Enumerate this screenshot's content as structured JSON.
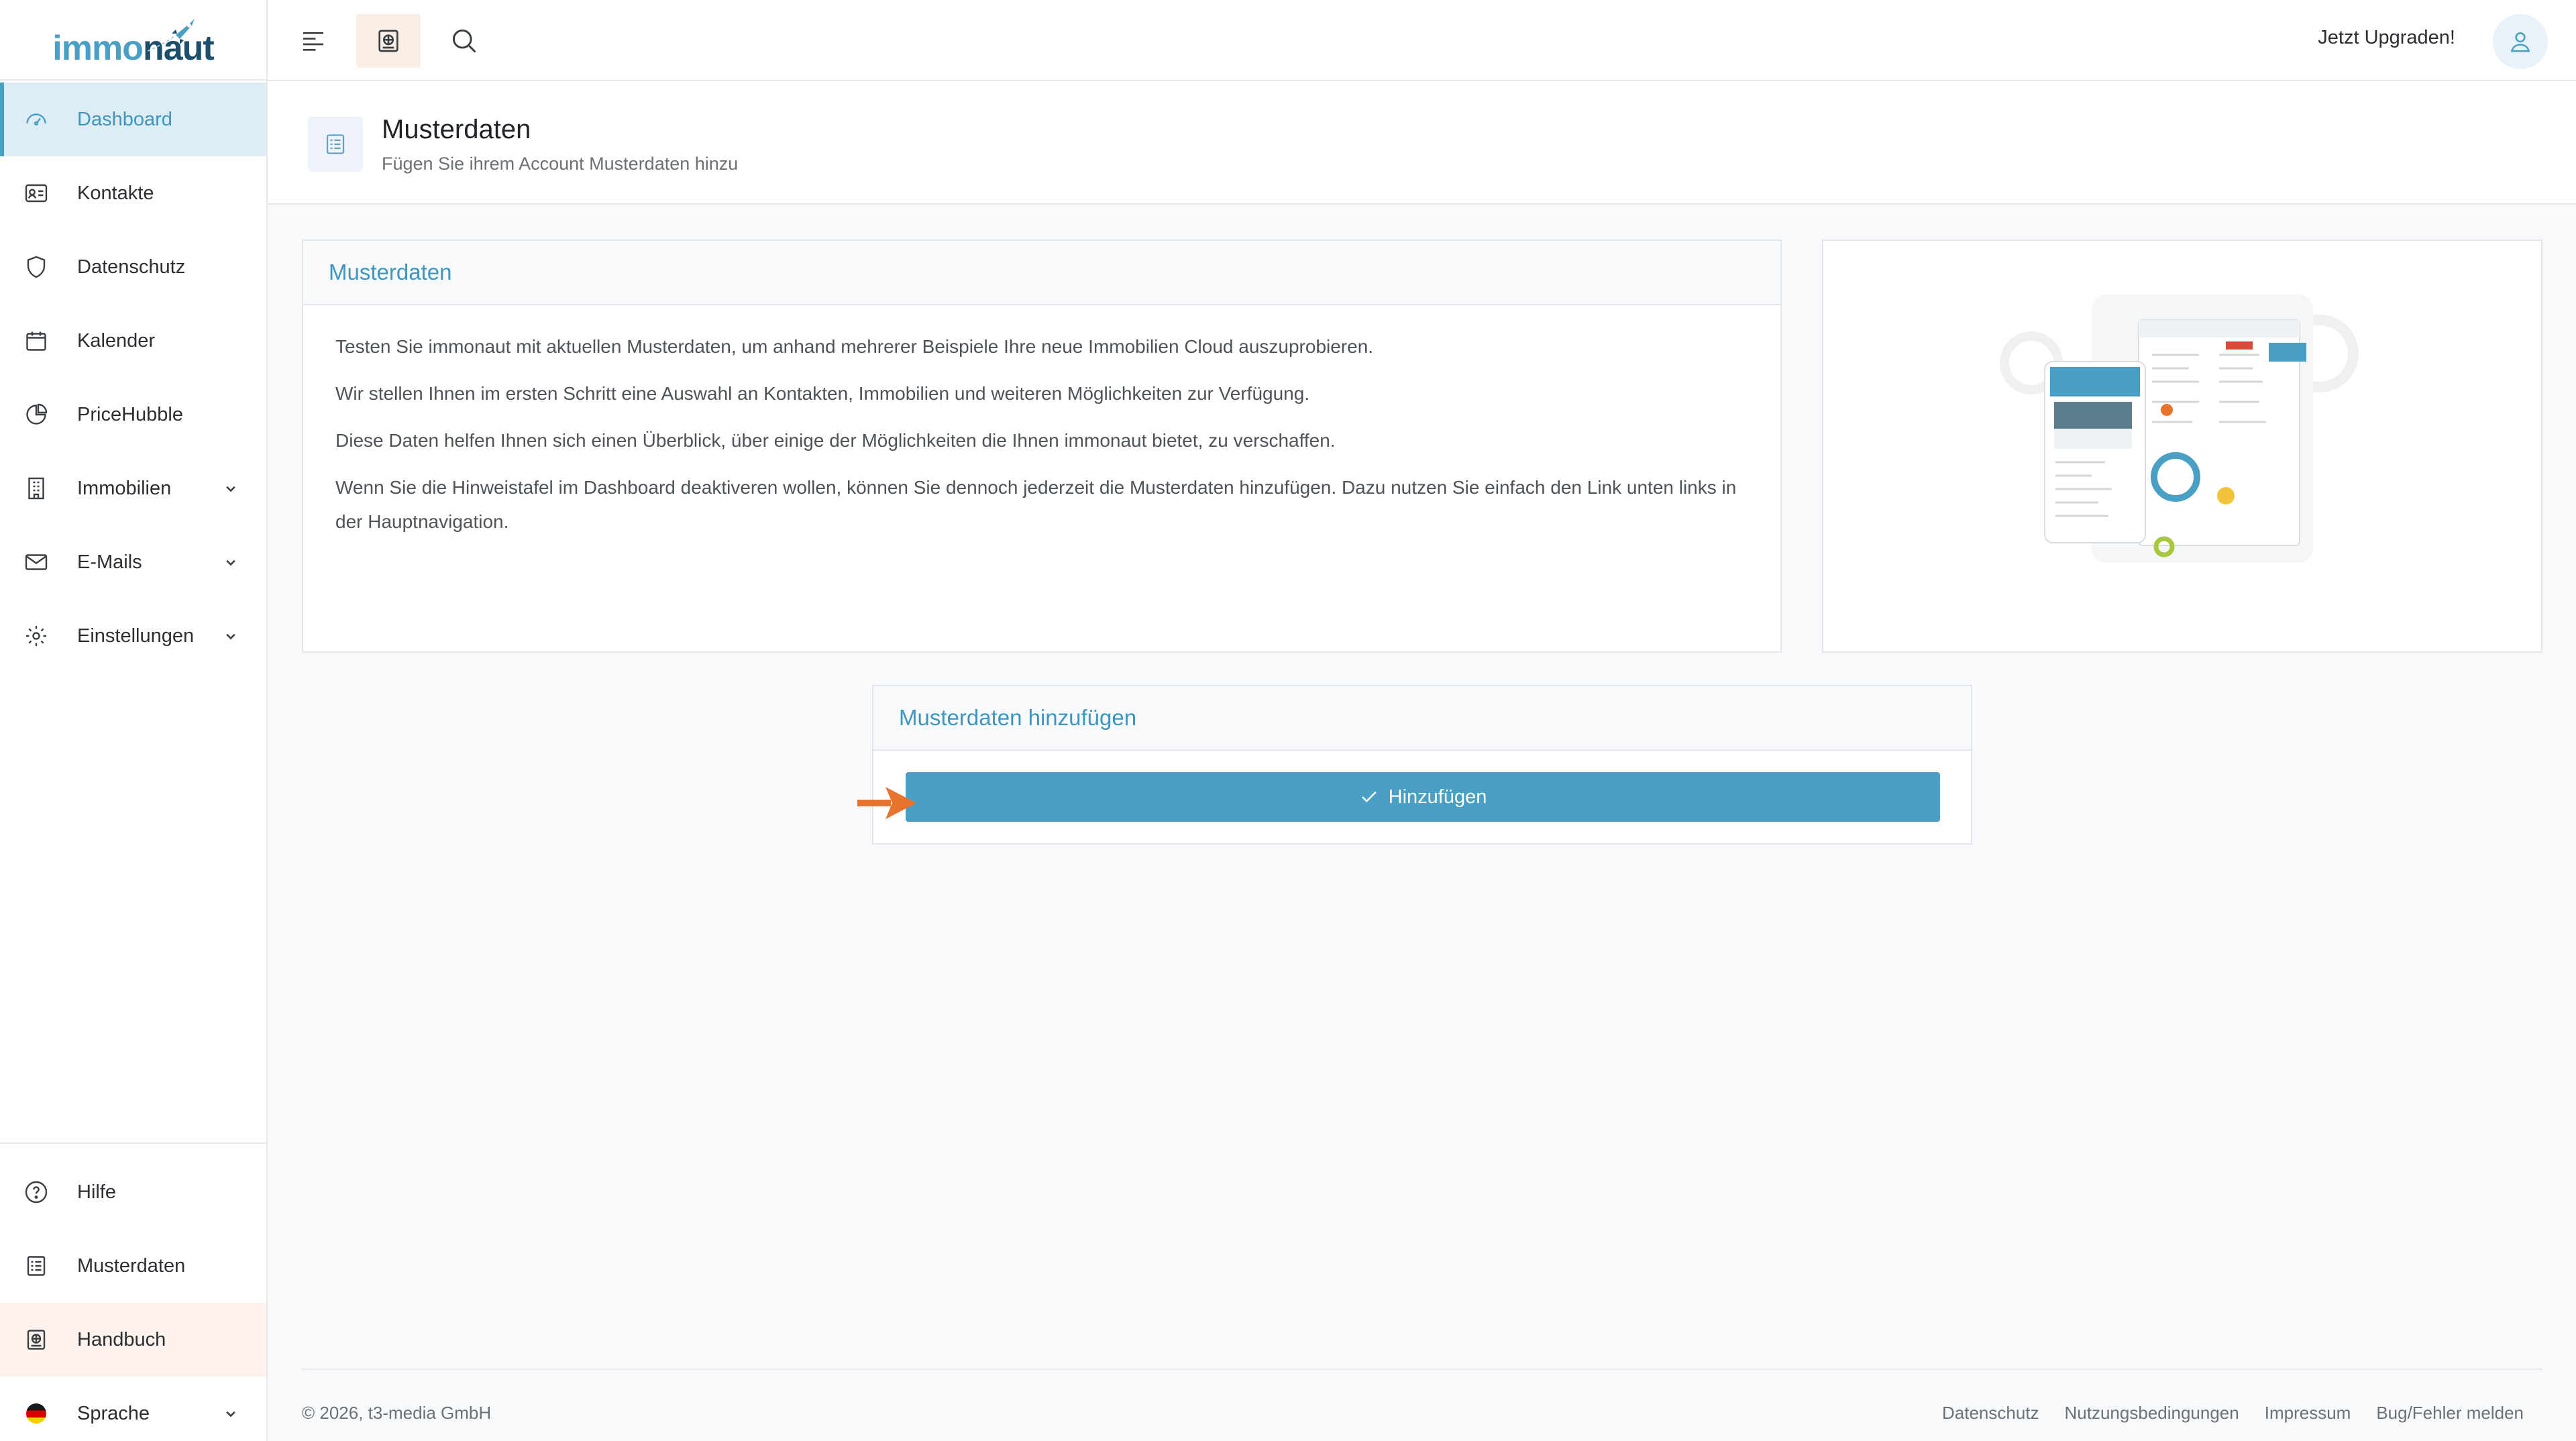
{
  "brand": {
    "logo_part1": "immo",
    "logo_part2": "naut"
  },
  "sidebar": {
    "items": [
      {
        "label": "Dashboard",
        "icon": "dashboard-icon",
        "active": true
      },
      {
        "label": "Kontakte",
        "icon": "contact-card-icon"
      },
      {
        "label": "Datenschutz",
        "icon": "shield-icon"
      },
      {
        "label": "Kalender",
        "icon": "calendar-icon"
      },
      {
        "label": "PriceHubble",
        "icon": "pie-chart-icon"
      },
      {
        "label": "Immobilien",
        "icon": "building-icon",
        "expandable": true
      },
      {
        "label": "E-Mails",
        "icon": "mail-icon",
        "expandable": true
      },
      {
        "label": "Einstellungen",
        "icon": "gear-icon",
        "expandable": true
      }
    ],
    "bottom_items": [
      {
        "label": "Hilfe",
        "icon": "help-icon"
      },
      {
        "label": "Musterdaten",
        "icon": "list-icon"
      },
      {
        "label": "Handbuch",
        "icon": "book-icon",
        "highlighted": true
      },
      {
        "label": "Sprache",
        "icon": "german-flag-icon",
        "expandable": true
      }
    ]
  },
  "topbar": {
    "menu_icon": "menu-icon",
    "book_icon": "book-icon",
    "search_icon": "search-icon",
    "upgrade_label": "Jetzt Upgraden!",
    "avatar_icon": "user-icon"
  },
  "page_header": {
    "title": "Musterdaten",
    "subtitle": "Fügen Sie ihrem Account Musterdaten hinzu"
  },
  "info_card": {
    "title": "Musterdaten",
    "paragraphs": [
      "Testen Sie immonaut mit aktuellen Musterdaten, um anhand mehrerer Beispiele Ihre neue Immobilien Cloud auszuprobieren.",
      "Wir stellen Ihnen im ersten Schritt eine Auswahl an Kontakten, Immobilien und weiteren Möglichkeiten zur Verfügung.",
      "Diese Daten helfen Ihnen sich einen Überblick, über einige der Möglichkeiten die Ihnen immonaut bietet, zu verschaffen.",
      "Wenn Sie die Hinweistafel im Dashboard deaktiveren wollen, können Sie dennoch jederzeit die Musterdaten hinzufügen. Dazu nutzen Sie einfach den Link unten links in der Hauptnavigation."
    ]
  },
  "add_card": {
    "title": "Musterdaten hinzufügen",
    "button_label": "Hinzufügen"
  },
  "footer": {
    "copyright": "© 2026, t3-media GmbH",
    "links": [
      "Datenschutz",
      "Nutzungsbedingungen",
      "Impressum",
      "Bug/Fehler melden"
    ]
  },
  "colors": {
    "accent": "#4aa0c4",
    "brand_dark": "#1d4e6b",
    "highlight": "#fdf3ec",
    "arrow": "#e8732c"
  }
}
